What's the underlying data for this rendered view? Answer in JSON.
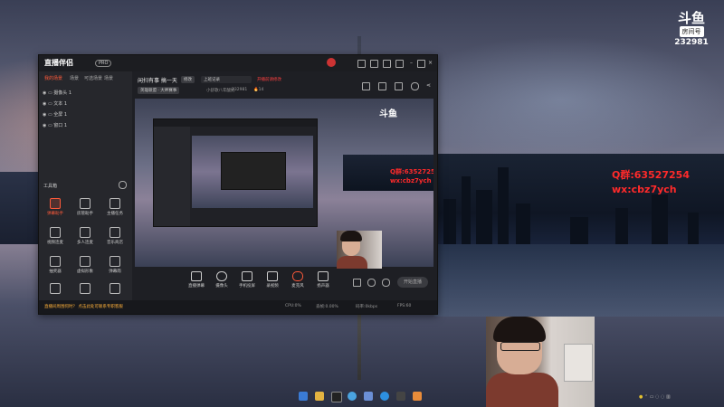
{
  "overlay": {
    "qq_text": "Q群:63527254",
    "wx_text": "wx:cbz7ych"
  },
  "logo": {
    "mark": "斗鱼",
    "label": "房间号",
    "room_id": "232981"
  },
  "app": {
    "name": "直播伴侣",
    "badge": "PRO",
    "tabs": [
      "我的场景",
      "场景",
      "可选场景",
      "场景"
    ],
    "scenes": [
      "摄像头 1",
      "文本 1",
      "全屏 1",
      "窗口 1"
    ],
    "tools_title": "工具箱",
    "tools": [
      {
        "label": "弹幕助手",
        "active": true
      },
      {
        "label": "房管助手",
        "active": false
      },
      {
        "label": "主播任务",
        "active": false
      },
      {
        "label": "视频连麦",
        "active": false
      },
      {
        "label": "多人连麦",
        "active": false
      },
      {
        "label": "音乐商店",
        "active": false
      },
      {
        "label": "抽奖器",
        "active": false
      },
      {
        "label": "虚拟形象",
        "active": false
      },
      {
        "label": "弹幕雨",
        "active": false
      },
      {
        "label": "",
        "active": false
      },
      {
        "label": "",
        "active": false
      },
      {
        "label": "",
        "active": false
      }
    ],
    "room_title": "闲扫有事 搞一天",
    "edit_label": "修改",
    "category": "上班记录",
    "hint": "开播前请修改",
    "tag": "英雄联盟 · 大神赛事",
    "anchor": "小舒歌八年酸奶",
    "room_id": "232981",
    "hot": "14",
    "controls": [
      "直播弹幕",
      "摄像头",
      "手机投屏",
      "录视频",
      "麦克风",
      "扬声器"
    ],
    "start_btn": "开始直播",
    "status_left": "直播间周围何时？ 点击此处可联系专职客服",
    "status_right": [
      "CPU:0%",
      "丢帧:0.00%",
      "码率:0kbps",
      "FPS:60"
    ]
  },
  "colors": {
    "accent": "#ff5a3a",
    "overlay_red": "#ff2a2a"
  }
}
